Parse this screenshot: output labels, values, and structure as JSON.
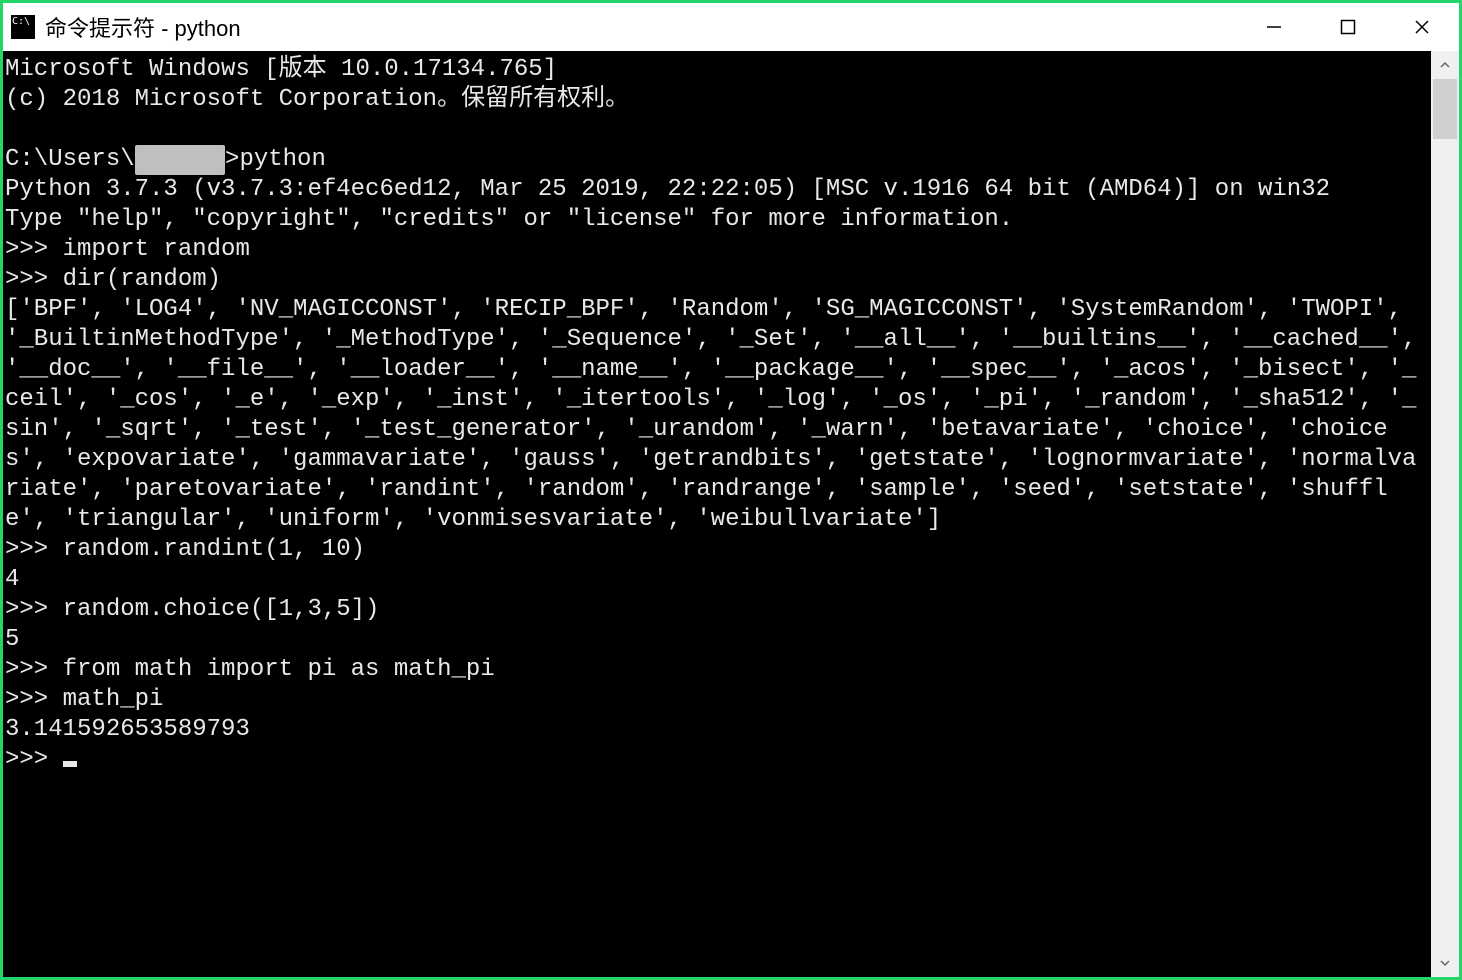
{
  "window": {
    "title": "命令提示符 - python"
  },
  "terminal": {
    "line_win_ver": "Microsoft Windows [版本 10.0.17134.765]",
    "line_copyright": "(c) 2018 Microsoft Corporation。保留所有权利。",
    "prompt_prefix": "C:\\Users\\",
    "prompt_user_redacted": "      ",
    "prompt_cmd": ">python",
    "python_banner": "Python 3.7.3 (v3.7.3:ef4ec6ed12, Mar 25 2019, 22:22:05) [MSC v.1916 64 bit (AMD64)] on win32",
    "python_help": "Type \"help\", \"copyright\", \"credits\" or \"license\" for more information.",
    "ps1": ">>> ",
    "in1": "import random",
    "in2": "dir(random)",
    "out2": "['BPF', 'LOG4', 'NV_MAGICCONST', 'RECIP_BPF', 'Random', 'SG_MAGICCONST', 'SystemRandom', 'TWOPI', '_BuiltinMethodType', '_MethodType', '_Sequence', '_Set', '__all__', '__builtins__', '__cached__', '__doc__', '__file__', '__loader__', '__name__', '__package__', '__spec__', '_acos', '_bisect', '_ceil', '_cos', '_e', '_exp', '_inst', '_itertools', '_log', '_os', '_pi', '_random', '_sha512', '_sin', '_sqrt', '_test', '_test_generator', '_urandom', '_warn', 'betavariate', 'choice', 'choices', 'expovariate', 'gammavariate', 'gauss', 'getrandbits', 'getstate', 'lognormvariate', 'normalvariate', 'paretovariate', 'randint', 'random', 'randrange', 'sample', 'seed', 'setstate', 'shuffle', 'triangular', 'uniform', 'vonmisesvariate', 'weibullvariate']",
    "in3": "random.randint(1, 10)",
    "out3": "4",
    "in4": "random.choice([1,3,5])",
    "out4": "5",
    "in5": "from math import pi as math_pi",
    "in6": "math_pi",
    "out6": "3.141592653589793"
  }
}
